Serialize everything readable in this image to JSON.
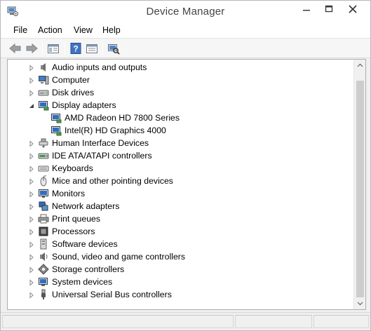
{
  "window": {
    "title": "Device Manager"
  },
  "menu": [
    "File",
    "Action",
    "View",
    "Help"
  ],
  "toolbar": [
    "back-icon",
    "forward-icon",
    "show-hide-console-tree-icon",
    "help-icon",
    "properties-icon",
    "scan-hardware-icon"
  ],
  "tree": [
    {
      "label": "Audio inputs and outputs",
      "icon": "speaker-icon",
      "expanded": false
    },
    {
      "label": "Computer",
      "icon": "computer-icon",
      "expanded": false
    },
    {
      "label": "Disk drives",
      "icon": "disk-drive-icon",
      "expanded": false
    },
    {
      "label": "Display adapters",
      "icon": "display-adapter-icon",
      "expanded": true,
      "children": [
        {
          "label": "AMD Radeon HD 7800 Series",
          "icon": "display-adapter-icon"
        },
        {
          "label": "Intel(R) HD Graphics 4000",
          "icon": "display-adapter-icon"
        }
      ]
    },
    {
      "label": "Human Interface Devices",
      "icon": "hid-icon",
      "expanded": false
    },
    {
      "label": "IDE ATA/ATAPI controllers",
      "icon": "ide-controller-icon",
      "expanded": false
    },
    {
      "label": "Keyboards",
      "icon": "keyboard-icon",
      "expanded": false
    },
    {
      "label": "Mice and other pointing devices",
      "icon": "mouse-icon",
      "expanded": false
    },
    {
      "label": "Monitors",
      "icon": "monitor-icon",
      "expanded": false
    },
    {
      "label": "Network adapters",
      "icon": "network-adapter-icon",
      "expanded": false
    },
    {
      "label": "Print queues",
      "icon": "printer-icon",
      "expanded": false
    },
    {
      "label": "Processors",
      "icon": "processor-icon",
      "expanded": false
    },
    {
      "label": "Software devices",
      "icon": "software-device-icon",
      "expanded": false
    },
    {
      "label": "Sound, video and game controllers",
      "icon": "sound-icon",
      "expanded": false
    },
    {
      "label": "Storage controllers",
      "icon": "storage-controller-icon",
      "expanded": false
    },
    {
      "label": "System devices",
      "icon": "system-devices-icon",
      "expanded": false
    },
    {
      "label": "Universal Serial Bus controllers",
      "icon": "usb-icon",
      "expanded": false
    }
  ]
}
